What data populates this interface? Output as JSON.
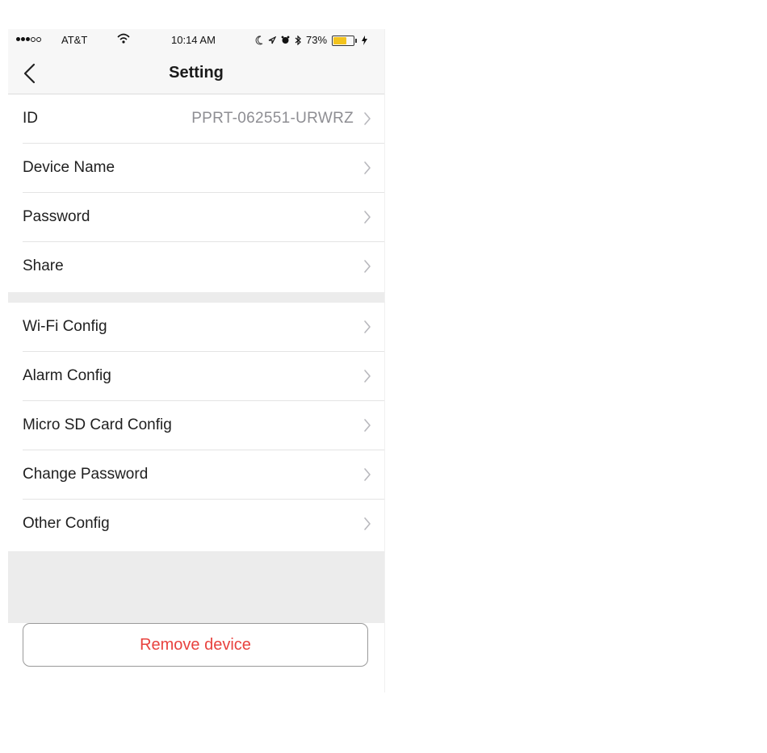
{
  "status_bar": {
    "carrier": "AT&T",
    "time": "10:14 AM",
    "battery_percent": "73%",
    "battery_level": 0.73,
    "battery_color": "#f2c31d",
    "signal_bars_filled": 3,
    "signal_bars_total": 5
  },
  "nav": {
    "title": "Setting",
    "back_icon": "chevron-left-icon"
  },
  "section1": [
    {
      "label": "ID",
      "value": "PPRT-062551-URWRZ"
    },
    {
      "label": "Device Name",
      "value": ""
    },
    {
      "label": "Password",
      "value": ""
    },
    {
      "label": "Share",
      "value": ""
    }
  ],
  "section2": [
    {
      "label": "Wi-Fi Config"
    },
    {
      "label": "Alarm Config"
    },
    {
      "label": "Micro SD Card Config"
    },
    {
      "label": "Change Password"
    },
    {
      "label": "Other Config"
    }
  ],
  "remove_button": {
    "label": "Remove device",
    "color": "#e8423e"
  }
}
